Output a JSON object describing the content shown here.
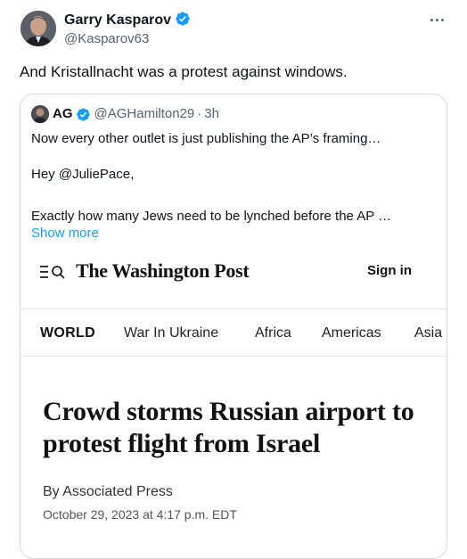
{
  "tweet": {
    "author_name": "Garry Kasparov",
    "author_handle": "@Kasparov63",
    "text": "And Kristallnacht was a protest against windows."
  },
  "quote": {
    "author_name": "AG",
    "author_handle": "@AGHamilton29",
    "separator": "·",
    "time": "3h",
    "lines": [
      "Now every other outlet is just publishing the AP’s framing…",
      "Hey @JuliePace,",
      "Exactly how many Jews need to be lynched before the AP …"
    ],
    "show_more": "Show more"
  },
  "article": {
    "logo": "The Washington Post",
    "sign_in": "Sign in",
    "nav": [
      "WORLD",
      "War In Ukraine",
      "Africa",
      "Americas",
      "Asia"
    ],
    "headline": "Crowd storms Russian airport to protest flight from Israel",
    "byline": "By Associated Press",
    "date": "October 29, 2023 at 4:17 p.m. EDT"
  },
  "colors": {
    "verified": "#1d9bf0",
    "link": "#1d9bf0",
    "secondary_text": "#536471",
    "border": "#cfd9de"
  },
  "icons": {
    "verified": "verified-badge-icon",
    "more": "more-horizontal-icon",
    "menu_search": "menu-search-icon"
  }
}
